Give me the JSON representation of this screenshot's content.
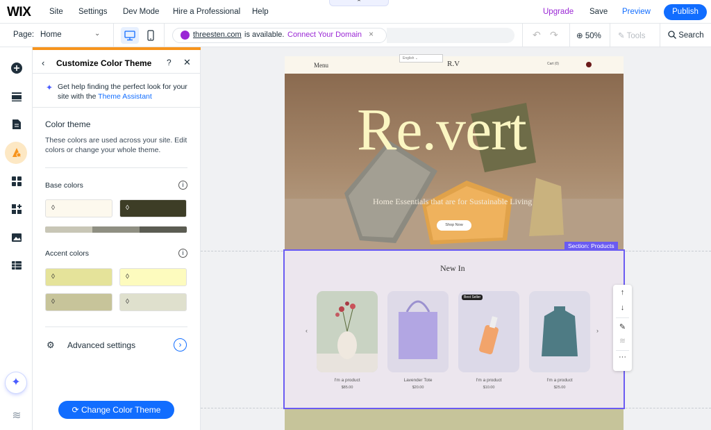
{
  "topbar": {
    "logo": "WIX",
    "menu": [
      "Site",
      "Settings",
      "Dev Mode",
      "Hire a Professional",
      "Help"
    ],
    "handle_glyph": "⌃",
    "upgrade": "Upgrade",
    "save": "Save",
    "preview": "Preview",
    "publish": "Publish"
  },
  "secondbar": {
    "page_label": "Page:",
    "page_value": "Home",
    "domain": "threesten.com",
    "domain_status": "is available.",
    "connect_link": "Connect Your Domain",
    "zoom": "50%",
    "tools": "Tools",
    "search": "Search"
  },
  "panel": {
    "title": "Customize Color Theme",
    "help_text": "Get help finding the perfect look for your site with the ",
    "help_link": "Theme Assistant",
    "section_title": "Color theme",
    "section_desc": "These colors are used across your site. Edit colors or change your whole theme.",
    "base_label": "Base colors",
    "accent_label": "Accent colors",
    "advanced": "Advanced settings",
    "change_button": "Change Color Theme",
    "base_colors": [
      "#fdf9ee",
      "#3d3d26"
    ],
    "strip_colors": [
      "#c8c6b6",
      "#8f8f82",
      "#5b5c52"
    ],
    "accent_colors": [
      "#e5e39a",
      "#fdfbbe",
      "#c7c49a",
      "#dfe0cd"
    ],
    "accent_main": "#116dff",
    "panel_accent": "#f7941d"
  },
  "site": {
    "menu": "Menu",
    "logo": "R.V",
    "cart": "Cart (0)",
    "language": "English",
    "hero_title": "Re.vert",
    "hero_subtitle": "Home Essentials that are for Sustainable Living",
    "shop_button": "Shop Now",
    "section_tag": "Section: Products",
    "new_in": "New In",
    "badge": "Best Seller",
    "products": [
      {
        "name": "I'm a product",
        "price": "$85.00",
        "bg": "#c9d3c3"
      },
      {
        "name": "Lavender Tote",
        "price": "$20.00",
        "bg": "#dedae8"
      },
      {
        "name": "I'm a product",
        "price": "$10.00",
        "bg": "#dcd9e8"
      },
      {
        "name": "I'm a product",
        "price": "$25.00",
        "bg": "#dedce9"
      }
    ]
  },
  "icons": {
    "rail": [
      "add-icon",
      "sections-icon",
      "pages-icon",
      "design-icon",
      "apps-icon",
      "business-icon",
      "media-icon",
      "cms-icon",
      "ai-assistant-icon",
      "layers-icon"
    ],
    "floating": [
      "move-up-icon",
      "move-down-icon",
      "edit-icon",
      "layers-icon",
      "more-icon"
    ]
  }
}
